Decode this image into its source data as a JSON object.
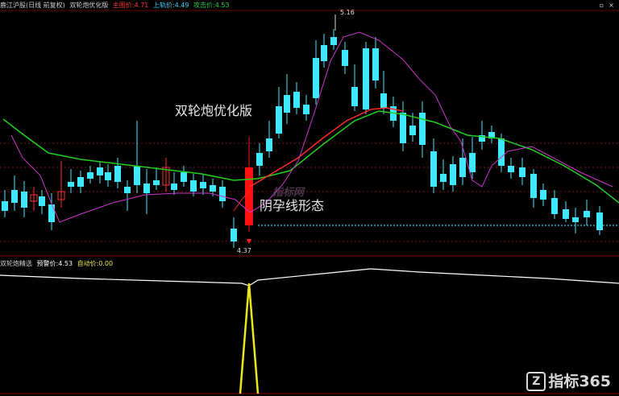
{
  "header": {
    "title": "鹿江沪股(日线 前复权)",
    "indicator_name": "双轮炮优化版",
    "values": [
      {
        "label": "主图价:4.71",
        "color": "#ff3333"
      },
      {
        "label": "上轨价:4.49",
        "color": "#3fd0ff"
      },
      {
        "label": "攻击价:4.53",
        "color": "#22cc44"
      }
    ]
  },
  "sub_header": {
    "title": "双轮炮精选",
    "values": [
      {
        "label": "预警价:4.53",
        "color": "#ffffff"
      },
      {
        "label": "自动价:0.00",
        "color": "#e8e84a"
      }
    ]
  },
  "annotations": {
    "main_title": "双轮炮优化版",
    "pattern": "阴孕线形态",
    "high_label": "5.16",
    "low_label": "4.37"
  },
  "watermark": "指标网",
  "brand": "指标365",
  "colors": {
    "up": "#ff3030",
    "down": "#3fe8ff",
    "ma_green": "#1fd01f",
    "ma_red": "#ff2a2a",
    "band": "#cc33cc",
    "signal": "#e8e81a",
    "grid": "#8a1010"
  }
}
